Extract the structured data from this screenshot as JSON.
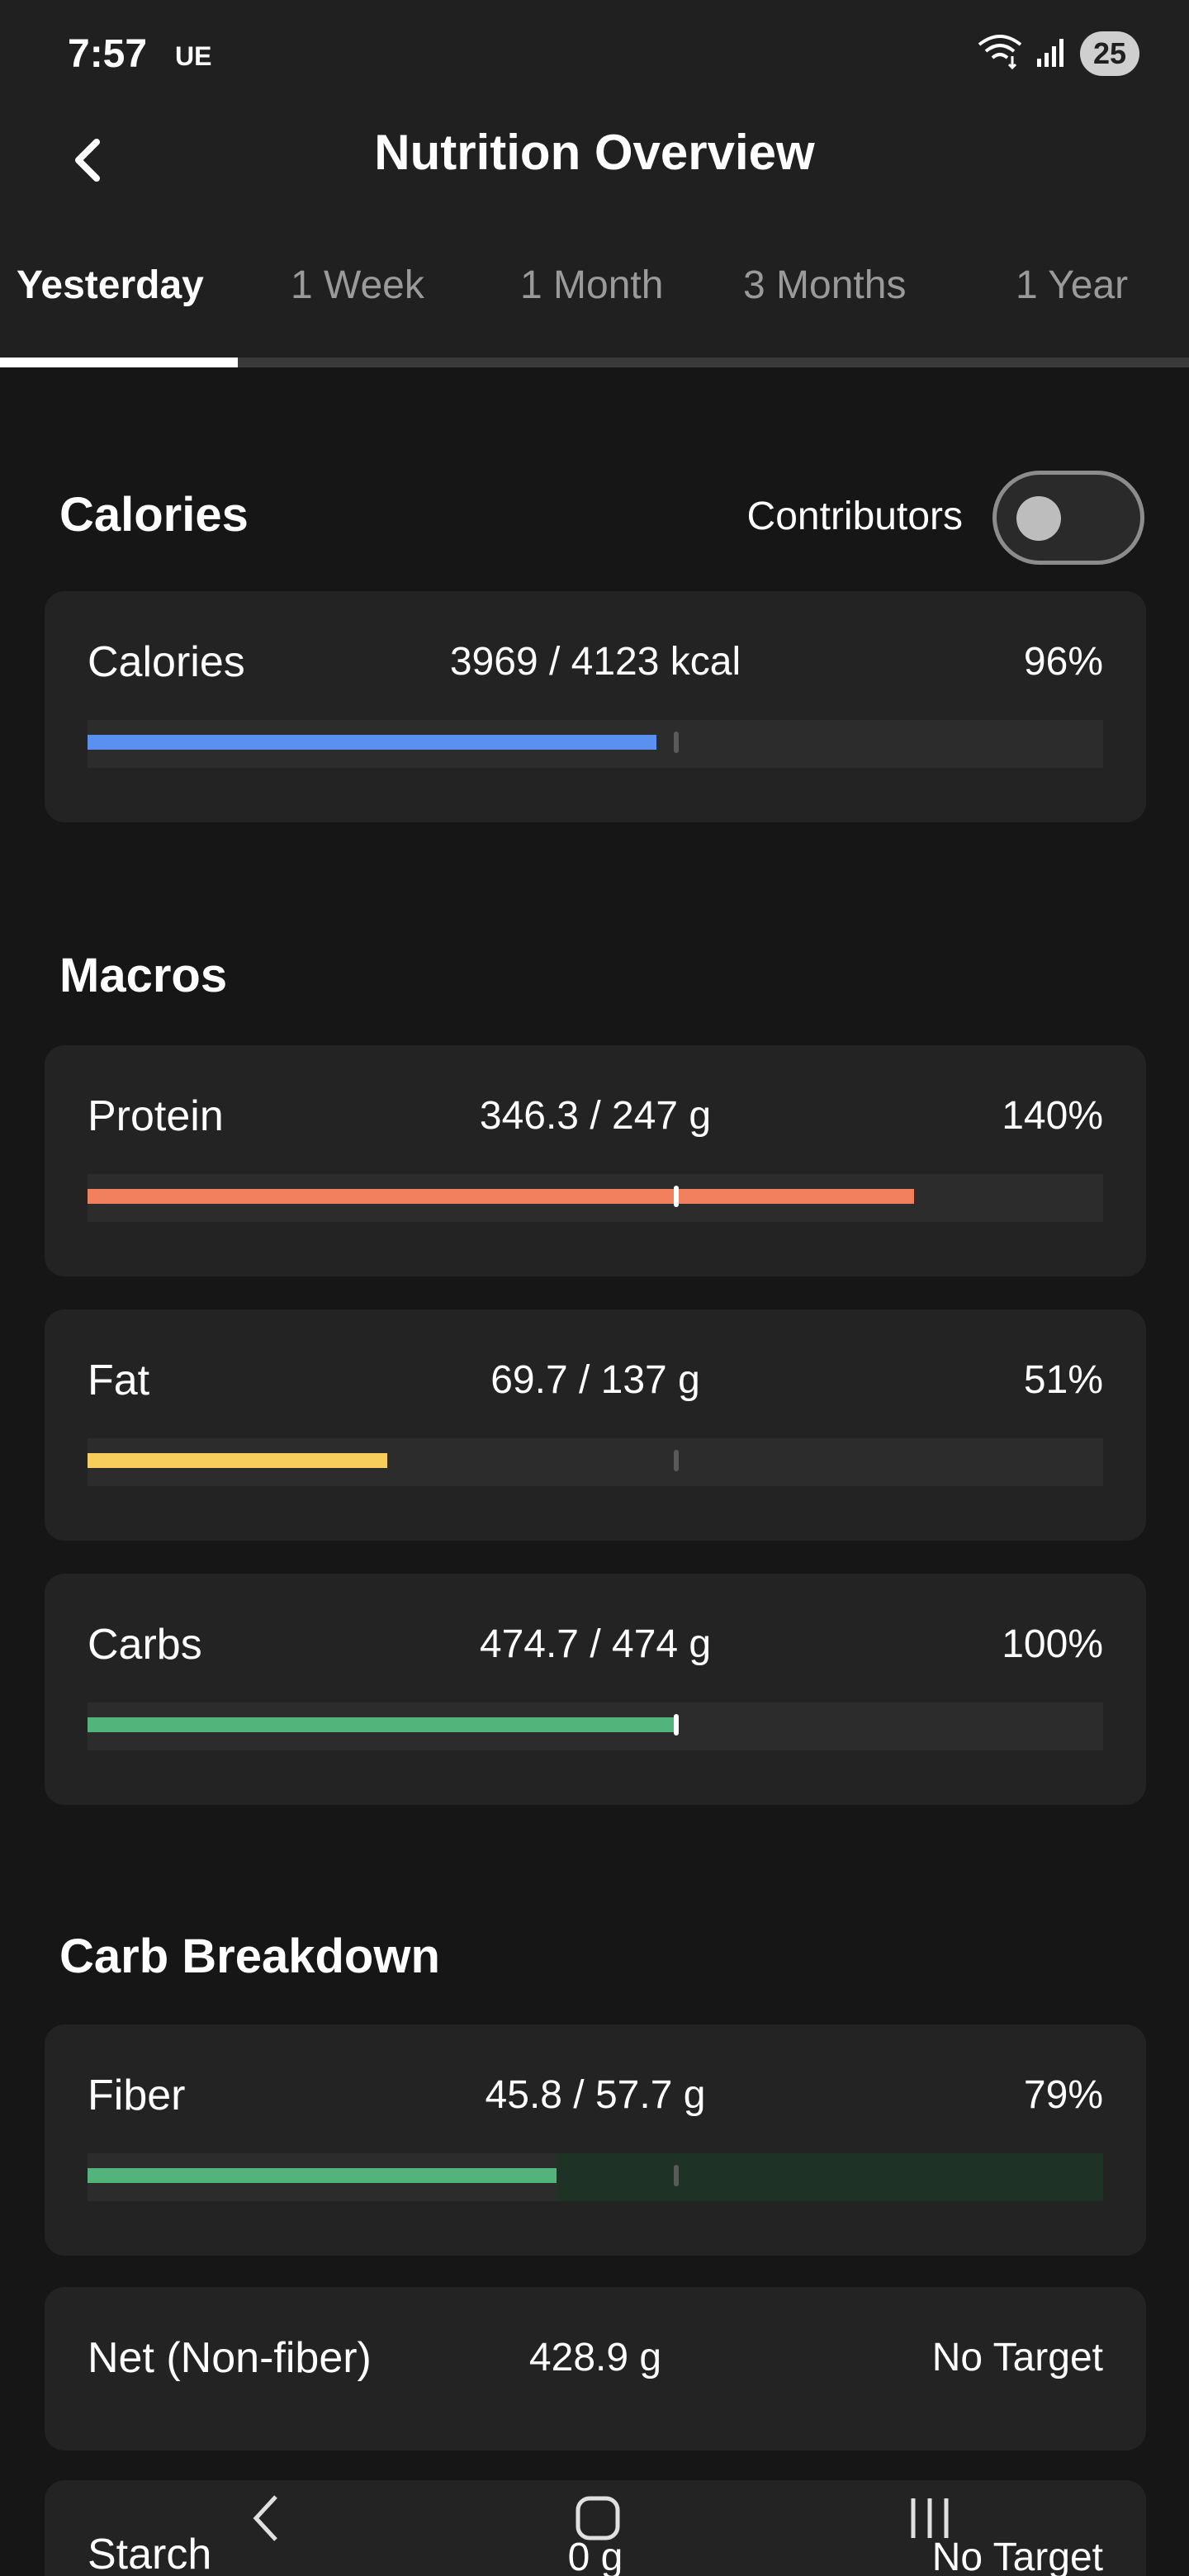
{
  "status_bar": {
    "time": "7:57",
    "carrier": "UE",
    "battery": "25"
  },
  "header": {
    "title": "Nutrition Overview"
  },
  "tabs": [
    {
      "label": "Yesterday",
      "active": true
    },
    {
      "label": "1 Week",
      "active": false
    },
    {
      "label": "1 Month",
      "active": false
    },
    {
      "label": "3 Months",
      "active": false
    },
    {
      "label": "1 Year",
      "active": false
    }
  ],
  "calories_section": {
    "title": "Calories",
    "contributors_label": "Contributors",
    "contributors_enabled": false,
    "items": [
      {
        "name": "Calories",
        "amount": "3969 / 4123 kcal",
        "percent": "96%",
        "fill_fraction": 0.56,
        "target_fraction": 0.58,
        "color": "#5b8ff0"
      }
    ]
  },
  "macros_section": {
    "title": "Macros",
    "items": [
      {
        "name": "Protein",
        "amount": "346.3 / 247 g",
        "percent": "140%",
        "fill_fraction": 0.814,
        "target_fraction": 0.58,
        "color": "#f2805e"
      },
      {
        "name": "Fat",
        "amount": "69.7 / 137 g",
        "percent": "51%",
        "fill_fraction": 0.295,
        "target_fraction": 0.58,
        "color": "#f7cd5c"
      },
      {
        "name": "Carbs",
        "amount": "474.7 / 474 g",
        "percent": "100%",
        "fill_fraction": 0.58,
        "target_fraction": 0.58,
        "color": "#52b47a"
      }
    ]
  },
  "carb_breakdown_section": {
    "title": "Carb Breakdown",
    "items": [
      {
        "name": "Fiber",
        "amount": "45.8 / 57.7 g",
        "percent": "79%",
        "fill_fraction": 0.462,
        "target_fraction": 0.58,
        "color": "#52b47a"
      },
      {
        "name": "Net (Non-fiber)",
        "amount": "428.9 g",
        "percent": "No Target"
      },
      {
        "name": "Starch",
        "amount": "0 g",
        "percent": "No Target"
      }
    ]
  },
  "nav_bar": {
    "icons": [
      "back-icon",
      "home-icon",
      "recents-icon"
    ]
  }
}
